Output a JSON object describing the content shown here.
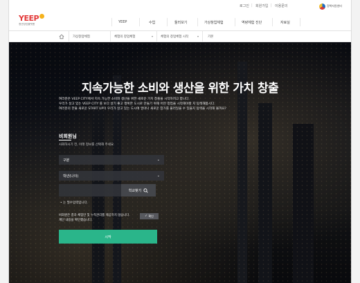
{
  "util_links": [
    "로그인",
    "회원가입",
    "이용문의"
  ],
  "gov_logo_text": "정책지원센터",
  "logo": {
    "word": "YEEP",
    "subtitle": "청년창업플랫폼"
  },
  "nav": [
    "YEEP",
    "수업",
    "둘러보기",
    "가상창업체험",
    "역량체험 진단",
    "자료실"
  ],
  "breadcrumb": [
    "가상창업체험",
    "체험의 창업체험",
    "체험의 창업체험 시작",
    "기본"
  ],
  "hero": {
    "title": "지속가능한 소비와 생산을 위한 가치 창출",
    "intro": [
      "여러분은 VEEP CITY에서 지속 가능한 소비와 생산을 위한 새로운 가치 창출을 시작하려고 합니다.",
      "우리가 살고 있는 VEEP CITY 를 보다 살기 좋고 행복한 도시로 만들기 위해 어떤 창업을 시작해야할 지 탐색해봅시다.",
      "여러분의 한줄 새로운 START UP이 우리가 살고 있는 도시에 얼마나 새로운 참가를 불러일을 수 있을지 탐색을 시작해 볼까요?"
    ]
  },
  "form": {
    "title": "비회원님",
    "desc": "사회하시기 전, 아래 정보를 선택해 주세요.",
    "select_gubun": "구분",
    "select_grade": "학년(나이)",
    "search_button": "학교찾기",
    "required_note": "는 필수입력입니다.",
    "notice_line1": "비회원은 결과 체험만 및 누적관리를 제공하지 않습니다.",
    "notice_line2": "계단 내용을 확인했습니다.",
    "confirm_label": "확인",
    "submit_label": "시작"
  }
}
